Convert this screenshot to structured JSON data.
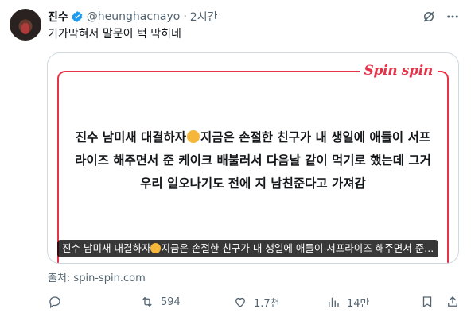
{
  "author": {
    "name": "진수",
    "handle": "@heunghacnayo",
    "separator": "·",
    "time": "2시간"
  },
  "tweet": {
    "text": "기가막혀서 말문이 턱 막히네"
  },
  "card": {
    "brand": "Spin spin",
    "body_part1": "진수 남미새 대결하자",
    "body_part2": "지금은 손절한 친구가 내 생일에 애들이 서프라이즈 해주면서 준 케이크 배불러서 다음날 같이 먹기로 했는데 그거 우리 일오나기도 전에 지 남친준다고 가져감",
    "caption_part1": "진수 남미새 대결하자",
    "caption_part2": "지금은 손절한 친구가 내 생일에 애들이 서프라이즈 해주면서 준..."
  },
  "source": "출처: spin-spin.com",
  "actions": {
    "replies": "",
    "retweets": "594",
    "likes": "1.7천",
    "views": "14만"
  },
  "colors": {
    "accent": "#e6334a",
    "verified": "#1d9bf0",
    "muted": "#536471"
  },
  "icons": [
    "verified-badge-icon",
    "grok-icon",
    "more-icon",
    "reply-icon",
    "retweet-icon",
    "like-icon",
    "views-icon",
    "bookmark-icon",
    "share-icon"
  ]
}
